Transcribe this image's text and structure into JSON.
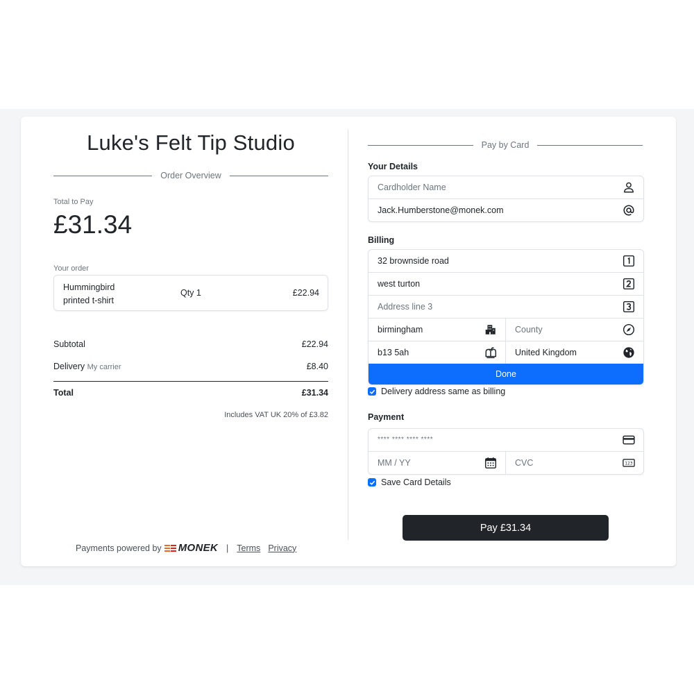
{
  "merchant": {
    "name": "Luke's Felt Tip Studio"
  },
  "order_overview": {
    "heading": "Order Overview",
    "total_label": "Total to Pay",
    "total_value": "£31.34",
    "your_order_label": "Your order",
    "item": {
      "name": "Hummingbird printed t-shirt",
      "qty": "Qty 1",
      "price": "£22.94"
    },
    "subtotal": {
      "label": "Subtotal",
      "value": "£22.94"
    },
    "delivery": {
      "label": "Delivery",
      "carrier": "My carrier",
      "value": "£8.40"
    },
    "total": {
      "label": "Total",
      "value": "£31.34"
    },
    "vat_note": "Includes VAT UK 20% of £3.82"
  },
  "footer": {
    "powered_by": "Payments powered by",
    "brand": "MONEK",
    "separator": "|",
    "terms": "Terms",
    "privacy": "Privacy"
  },
  "pay_by_card": {
    "heading": "Pay by Card",
    "your_details": {
      "label": "Your Details",
      "cardholder_placeholder": "Cardholder Name",
      "email_value": "Jack.Humberstone@monek.com"
    },
    "billing": {
      "label": "Billing",
      "address_line_1": "32 brownside road",
      "address_line_2": "west turton",
      "address_line_3_placeholder": "Address line 3",
      "city": "birmingham",
      "county_placeholder": "County",
      "postcode": "b13 5ah",
      "country": "United Kingdom",
      "done_label": "Done"
    },
    "delivery_same_label": "Delivery address same as billing",
    "payment": {
      "label": "Payment",
      "card_number_placeholder": "**** **** **** ****",
      "expiry_placeholder": "MM / YY",
      "cvc_placeholder": "CVC",
      "save_card_label": "Save Card Details"
    },
    "pay_button_label": "Pay £31.34"
  },
  "colors": {
    "primary": "#0d6efd",
    "dark": "#212529",
    "muted": "#6c757d",
    "page_band": "#f4f5f7",
    "brand_orange": "#f26522"
  },
  "icons": [
    "person-icon",
    "at-sign-icon",
    "one-square-icon",
    "two-square-icon",
    "three-square-icon",
    "buildings-icon",
    "compass-icon",
    "mailbox-icon",
    "globe-icon",
    "credit-card-icon",
    "calendar-icon",
    "cvc-123-icon",
    "checkmark-icon",
    "monek-logo-icon"
  ]
}
